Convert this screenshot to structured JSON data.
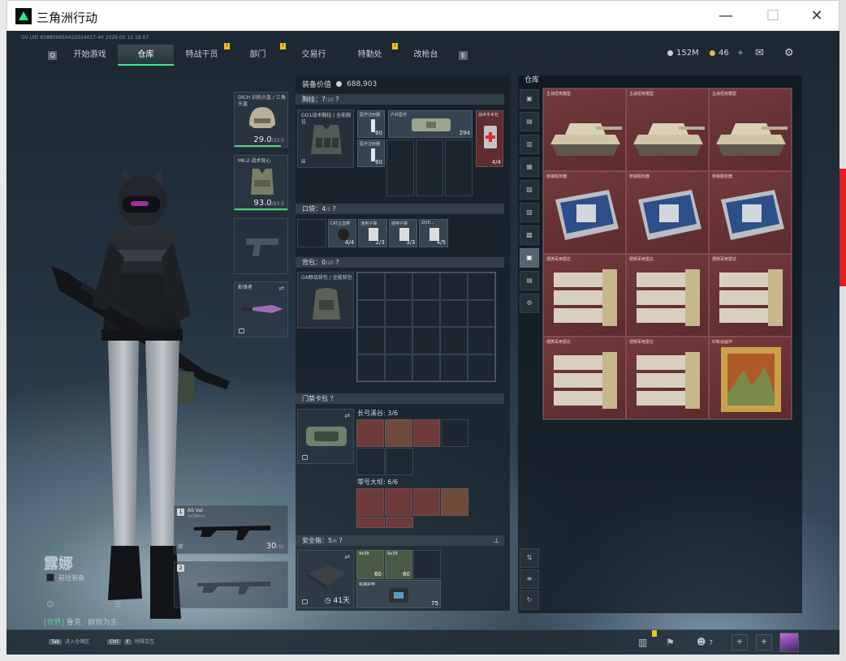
{
  "window": {
    "title": "三角洲行动",
    "minimize": "—",
    "maximize": "☐",
    "close": "✕"
  },
  "topbar": {
    "uid": "OV UID 838809656422024017-40 2026 05 15 18 07",
    "nav_tabs": [
      {
        "label": "开始游戏",
        "badge": ""
      },
      {
        "label": "仓库",
        "badge": "",
        "active": true
      },
      {
        "label": "特战干员",
        "badge": "!"
      },
      {
        "label": "部门",
        "badge": "!"
      },
      {
        "label": "交易行",
        "badge": ""
      },
      {
        "label": "特勤处",
        "badge": "!"
      },
      {
        "label": "改枪台",
        "badge": ""
      }
    ],
    "left_arrow": "Q",
    "right_arrow": "E",
    "money": "152M",
    "coins": "46",
    "add": "+"
  },
  "loadout": {
    "helmet": {
      "label": "DICH 训练头盔 / 三角头盔",
      "value": "29.0",
      "max": "/33.0"
    },
    "armor": {
      "label": "MK-2 战术背心",
      "value": "93.0",
      "max": "/93.0"
    },
    "pistol": {
      "label": ""
    },
    "melee": {
      "label": "影锋者"
    },
    "primary": {
      "slot": "1",
      "label": "AS Val",
      "sub": "9x39mm",
      "ammo": "30",
      "ammo_max": "/30"
    },
    "secondary": {
      "slot": "2"
    }
  },
  "character": {
    "name": "露娜",
    "status": "前往装备",
    "chat_channel": "[世界]",
    "chat_text": "鲁克 · 欧锁为主..."
  },
  "center": {
    "equip_label": "装备价值",
    "equip_value": "688,903",
    "chest": {
      "title": "胸挂",
      "count": "7",
      "cap": "/10"
    },
    "chest_rig": {
      "label": "GO1战术胸挂 / 全能胸挂"
    },
    "chest_items": [
      {
        "label": "医疗注射器",
        "count": "60"
      },
      {
        "label": "医疗注射器",
        "count": "60"
      },
      {
        "label": "户外医疗",
        "count": "294"
      },
      {
        "label": "战术手术包",
        "count": "4/4"
      }
    ],
    "pockets": {
      "title": "口袋",
      "count": "4",
      "cap": "/5"
    },
    "pocket_items": [
      {
        "label": "CAT止血带",
        "count": "4/4"
      },
      {
        "label": "通用子弹",
        "count": "2/3"
      },
      {
        "label": "通用子弹",
        "count": "3/3"
      },
      {
        "label": "DVE...",
        "count": "4/5"
      }
    ],
    "backpack": {
      "title": "背包",
      "count": "0",
      "cap": "/20"
    },
    "backpack_item": {
      "label": "GA野战背包 / 全能背包"
    },
    "keycard": {
      "title": "门禁卡包"
    },
    "key_groups": [
      {
        "name": "长弓溪谷",
        "count": "3/6"
      },
      {
        "name": "零号大坝",
        "count": "6/6"
      }
    ],
    "safebox": {
      "title": "安全箱",
      "count": "5",
      "cap": "/6",
      "days": "41天"
    },
    "safe_items": [
      {
        "label": "9x39",
        "count": "60"
      },
      {
        "label": "9x39",
        "count": "60"
      },
      {
        "label": "标准护甲",
        "count": "75"
      }
    ]
  },
  "warehouse": {
    "title": "仓库",
    "items": [
      {
        "label": "主战坦克模型",
        "kind": "tank"
      },
      {
        "label": "主战坦克模型",
        "kind": "tank"
      },
      {
        "label": "主战坦克模型",
        "kind": "tank"
      },
      {
        "label": "桥接服务器",
        "kind": "server"
      },
      {
        "label": "桥接服务器",
        "kind": "server"
      },
      {
        "label": "桥接服务器",
        "kind": "server"
      },
      {
        "label": "便携军用雷达",
        "kind": "radar"
      },
      {
        "label": "便携军用雷达",
        "kind": "radar"
      },
      {
        "label": "便携军用雷达",
        "kind": "radar"
      },
      {
        "label": "便携军用雷达",
        "kind": "radar"
      },
      {
        "label": "便携军用雷达",
        "kind": "radar"
      },
      {
        "label": "印象派画作",
        "kind": "painting"
      }
    ]
  },
  "bottombar": {
    "tab_key": "Tab",
    "tab_label": "进入仓储区",
    "ctrl_key": "Ctrl",
    "f_key": "F",
    "ctrl_label": "特殊交互",
    "friends": "7"
  },
  "colors": {
    "accent": "#3ee69a",
    "badge": "#f0c020",
    "item_red": "#6e2e30"
  }
}
